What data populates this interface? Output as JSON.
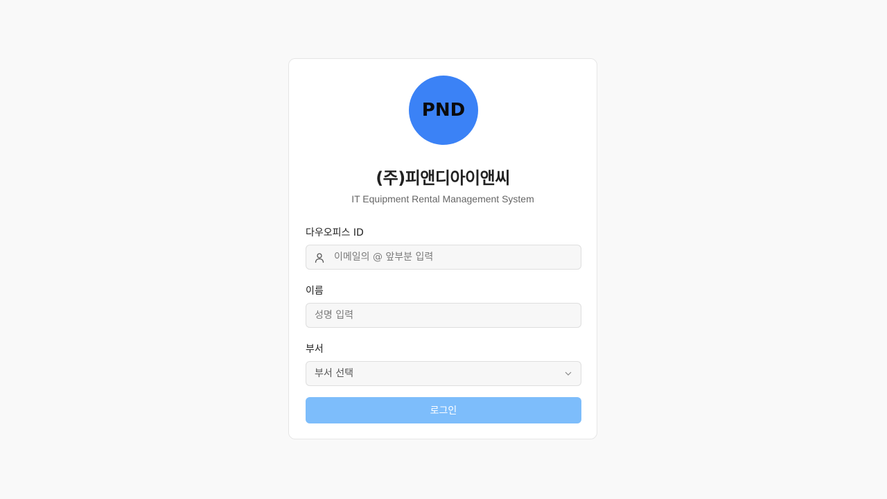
{
  "logo": {
    "text": "PND",
    "color": "#3b82f6"
  },
  "company": {
    "name": "(주)피앤디아이앤씨"
  },
  "subtitle": "IT Equipment Rental Management System",
  "form": {
    "daouoffice_id": {
      "label": "다우오피스 ID",
      "value": "",
      "placeholder": "이메일의 @ 앞부분 입력",
      "icon": "user-icon"
    },
    "name": {
      "label": "이름",
      "value": "",
      "placeholder": "성명 입력"
    },
    "department": {
      "label": "부서",
      "selected": "부서 선택",
      "icon": "chevron-down-icon"
    },
    "login_button": {
      "label": "로그인",
      "color": "#7dbdfb"
    }
  }
}
